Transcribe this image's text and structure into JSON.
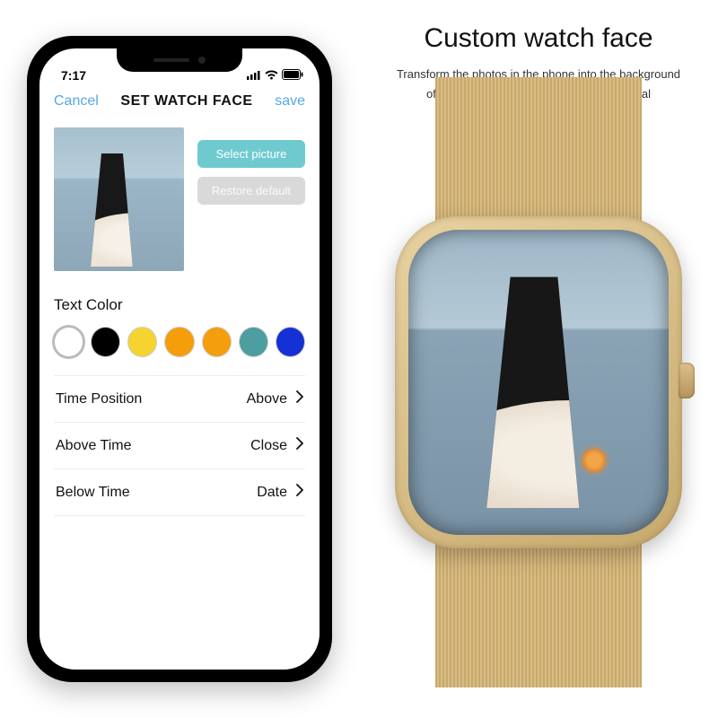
{
  "status": {
    "time": "7:17"
  },
  "nav": {
    "cancel": "Cancel",
    "title": "SET WATCH FACE",
    "save": "save"
  },
  "buttons": {
    "select": "Select picture",
    "restore": "Restore default"
  },
  "textcolor": {
    "label": "Text Color",
    "colors": [
      "#ffffff",
      "#000000",
      "#f5d431",
      "#f59e0b",
      "#f59e0b",
      "#4c9ea0",
      "#1431d6"
    ],
    "selected": 0
  },
  "rows": [
    {
      "label": "Time Position",
      "value": "Above"
    },
    {
      "label": "Above Time",
      "value": "Close"
    },
    {
      "label": "Below Time",
      "value": "Date"
    }
  ],
  "promo": {
    "headline": "Custom watch face",
    "line1": "Transform the photos in the phone into the background",
    "line2": "of the dial, and customize the exclusive dial"
  }
}
